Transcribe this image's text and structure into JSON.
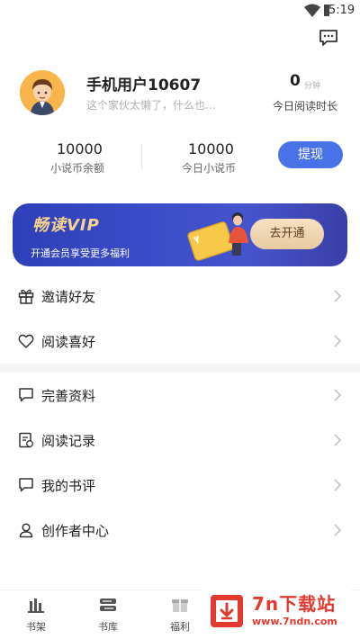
{
  "status_bar": {
    "time": "5:19"
  },
  "profile": {
    "username": "手机用户10607",
    "signature": "这个家伙太懒了，什么也...",
    "read_minutes": "0",
    "read_unit": "分钟",
    "read_label": "今日阅读时长"
  },
  "stats": [
    {
      "value": "10000",
      "label": "小说币余额"
    },
    {
      "value": "10000",
      "label": "今日小说币"
    }
  ],
  "withdraw_label": "提现",
  "vip": {
    "title": "畅读VIP",
    "subtitle": "开通会员享受更多福利",
    "button": "去开通",
    "colors": {
      "gold": "#f6d48a",
      "banner": "#3b4cc8"
    }
  },
  "menu": [
    {
      "label": "邀请好友",
      "icon": "gift-icon"
    },
    {
      "label": "阅读喜好",
      "icon": "heart-icon"
    },
    {
      "label": "完善资料",
      "icon": "chat-icon"
    },
    {
      "label": "阅读记录",
      "icon": "record-icon"
    },
    {
      "label": "我的书评",
      "icon": "comment-icon"
    },
    {
      "label": "创作者中心",
      "icon": "user-icon"
    }
  ],
  "tabs": [
    {
      "label": "书架",
      "icon": "bookshelf-icon"
    },
    {
      "label": "书库",
      "icon": "library-icon"
    },
    {
      "label": "福利",
      "icon": "welfare-icon"
    }
  ],
  "watermark": {
    "title": "7n下载站",
    "url": "www.7ndn.com"
  },
  "colors": {
    "accent": "#4a72e8",
    "watermark": "#e23a2f"
  }
}
